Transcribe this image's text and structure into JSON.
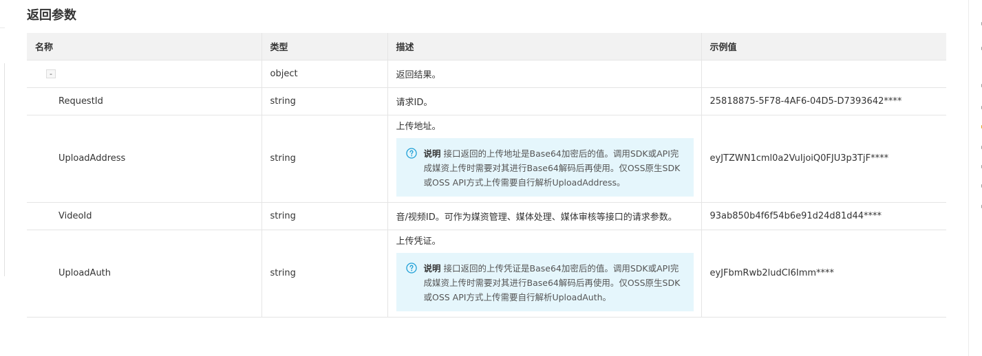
{
  "section": {
    "title": "返回参数"
  },
  "table": {
    "headers": [
      "名称",
      "类型",
      "描述",
      "示例值"
    ],
    "root": {
      "toggle": "-",
      "type": "object",
      "description": "返回结果。",
      "example": ""
    },
    "rows": [
      {
        "name": "RequestId",
        "type": "string",
        "description": "请求ID。",
        "example": "25818875-5F78-4AF6-04D5-D7393642****"
      },
      {
        "name": "UploadAddress",
        "type": "string",
        "description": "上传地址。",
        "note_label": "说明",
        "note_text": "接口返回的上传地址是Base64加密后的值。调用SDK或API完成媒资上传时需要对其进行Base64解码后再使用。仅OSS原生SDK或OSS API方式上传需要自行解析UploadAddress。",
        "example": "eyJTZWN1cml0a2VuIjoiQ0FJU3p3TjF****"
      },
      {
        "name": "VideoId",
        "type": "string",
        "description": "音/视频ID。可作为媒资管理、媒体处理、媒体审核等接口的请求参数。",
        "example": "93ab850b4f6f54b6e91d24d81d44****"
      },
      {
        "name": "UploadAuth",
        "type": "string",
        "description": "上传凭证。",
        "note_label": "说明",
        "note_text": "接口返回的上传凭证是Base64加密后的值。调用SDK或API完成媒资上传时需要对其进行Base64解码后再使用。仅OSS原生SDK或OSS API方式上传需要自行解析UploadAuth。",
        "example": "eyJFbmRwb2ludCI6Imm****"
      }
    ]
  },
  "icons": {
    "note": "question-circle-icon",
    "toggle": "collapse-icon"
  },
  "colors": {
    "header_bg": "#f2f2f2",
    "note_bg": "#e5f6fc",
    "note_icon": "#1e9fd6",
    "border": "#e4e4e4"
  }
}
